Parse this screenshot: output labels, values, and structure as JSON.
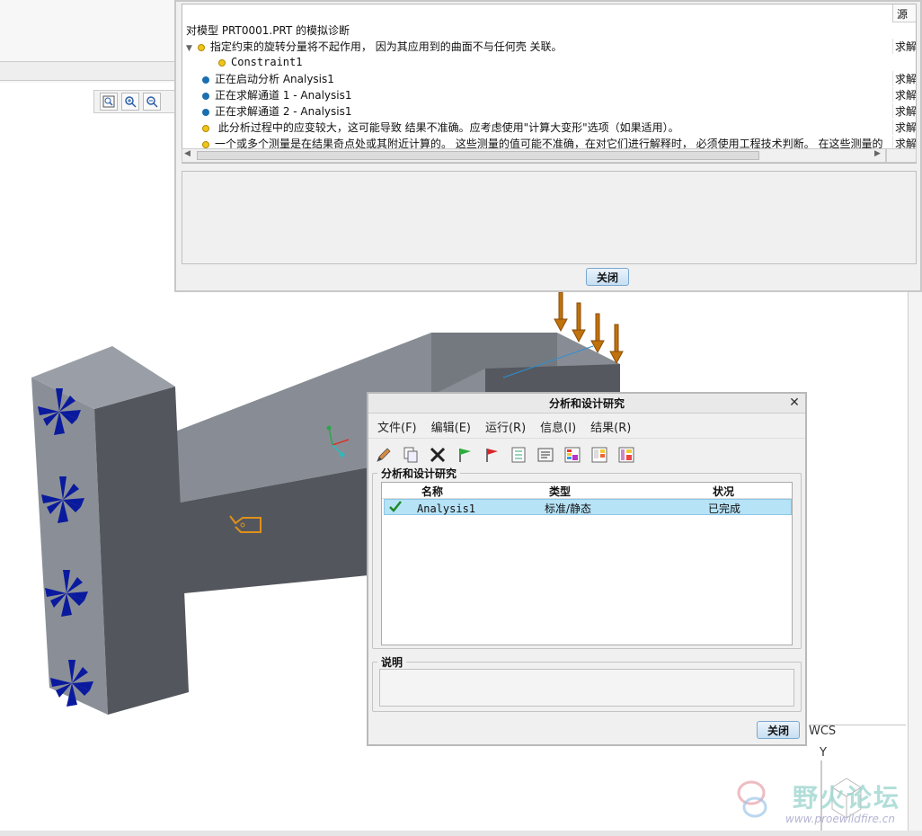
{
  "diagnostics": {
    "source_header": "源",
    "lines": [
      {
        "text": "对模型 PRT0001.PRT 的模拟诊断",
        "source": "",
        "kind": "title"
      },
      {
        "text": "指定约束的旋转分量将不起作用， 因为其应用到的曲面不与任何壳 关联。",
        "source": "求解器",
        "kind": "warning",
        "expandable": true
      },
      {
        "text": "Constraint1",
        "source": "",
        "kind": "warning-child"
      },
      {
        "text": "正在启动分析 Analysis1",
        "source": "求解器",
        "kind": "info"
      },
      {
        "text": "正在求解通道 1 - Analysis1",
        "source": "求解器",
        "kind": "info"
      },
      {
        "text": "正在求解通道 2 - Analysis1",
        "source": "求解器",
        "kind": "info"
      },
      {
        "text": "  此分析过程中的应变较大，这可能导致 结果不准确。应考虑使用\"计算大变形\"选项（如果适用）。",
        "source": "求解器",
        "kind": "warning"
      },
      {
        "text": "一个或多个测量是在结果奇点处或其附近计算的。 这些测量的值可能不准确，在对它们进行解释时， 必须使用工程技术判断。 在这些测量的",
        "source": "求解器",
        "kind": "warning"
      }
    ],
    "close_label": "关闭"
  },
  "view_toolbar": {
    "icons": [
      "zoom-fit-icon",
      "zoom-in-icon",
      "zoom-out-icon"
    ]
  },
  "analysis_dialog": {
    "title": "分析和设计研究",
    "menu": [
      "文件(F)",
      "编辑(E)",
      "运行(R)",
      "信息(I)",
      "结果(R)"
    ],
    "toolbar_icons": [
      "edit-pencil-icon",
      "copy-icon",
      "delete-x-icon",
      "green-flag-icon",
      "red-flag-icon",
      "checklist-icon",
      "summary-icon",
      "results-rainbow-icon",
      "results-window-icon",
      "results-compare-icon"
    ],
    "group_label": "分析和设计研究",
    "columns": [
      "名称",
      "类型",
      "状况"
    ],
    "rows": [
      {
        "name": "Analysis1",
        "type": "标准/静态",
        "status": "已完成"
      }
    ],
    "description_label": "说明",
    "description_value": "",
    "close_label": "关闭"
  },
  "wcs": {
    "label": "WCS",
    "axis": "Y"
  },
  "watermark": {
    "text": "野火论坛",
    "url": "www.proewildfire.cn"
  },
  "colors": {
    "model_light": "#858a92",
    "model_dark": "#52565c",
    "constraint": "#0a1a9e",
    "load": "#c0720c",
    "selection": "#a8dcf4"
  }
}
